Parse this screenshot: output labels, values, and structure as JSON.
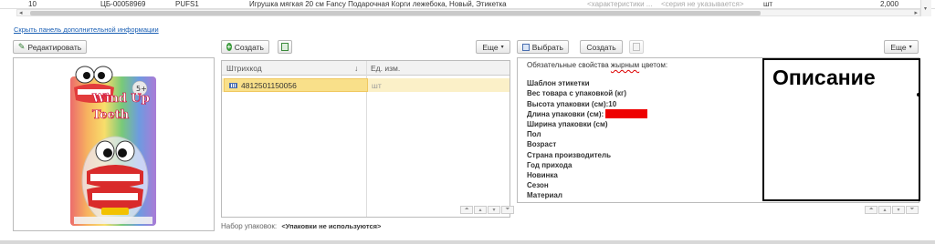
{
  "top_row": {
    "num": "10",
    "code": "ЦБ-00058969",
    "article": "PUFS1",
    "name": "Игрушка мягкая 20 см Fancy Подарочная Корги лежебока, Новый, Этикетка",
    "characteristics": "<характеристики ...",
    "series": "<серия не указывается>",
    "unit": "шт",
    "qty": "2,000"
  },
  "hide_panel_link": "Скрыть панель дополнительной информации",
  "toolbar": {
    "edit": "Редактировать",
    "create": "Создать",
    "more": "Еще",
    "select": "Выбрать",
    "create2": "Создать",
    "more2": "Еще"
  },
  "barcode_table": {
    "headers": [
      "Штрихкод",
      "Ед. изм."
    ],
    "rows": [
      {
        "barcode": "4812501150056",
        "unit": "шт"
      }
    ],
    "sort_icon": "↓"
  },
  "packaging": {
    "label": "Набор упаковок:",
    "value": "<Упаковки не используются>"
  },
  "properties": {
    "header_prefix": "Обязательные свойства ",
    "header_bold": "жырным",
    "header_suffix": " цветом:",
    "lines": [
      "Шаблон этикетки",
      "Вес товара с упаковкой (кг)",
      "Высота упаковки (см):10",
      "Длина упаковки (см):",
      "Ширина упаковки (см)",
      "Пол",
      "Возраст",
      "Страна производитель",
      "Год прихода",
      "Новинка",
      "Сезон",
      "Материал"
    ]
  },
  "description": {
    "title": "Описание"
  },
  "image_text": {
    "line1": "Wind Up",
    "line2": "Teeth",
    "badge": "5+"
  },
  "colors": {
    "highlight_row": "#fbf0c8",
    "selected_cell": "#f9e08a",
    "red_mark": "#ee0000",
    "link": "#1a5fb4"
  }
}
